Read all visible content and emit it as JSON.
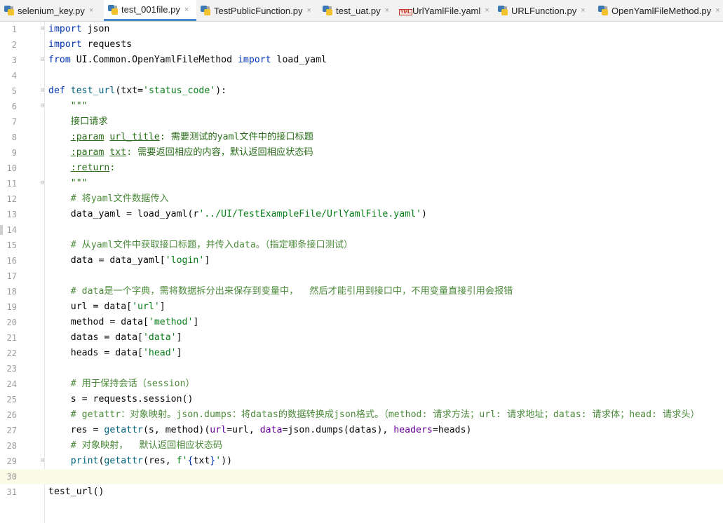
{
  "tabs": [
    {
      "label": "selenium_key.py",
      "icon": "python-file-icon",
      "active": false
    },
    {
      "label": "test_001file.py",
      "icon": "python-file-icon",
      "active": true
    },
    {
      "label": "TestPublicFunction.py",
      "icon": "python-file-icon",
      "active": false
    },
    {
      "label": "test_uat.py",
      "icon": "python-file-icon",
      "active": false
    },
    {
      "label": "UrlYamlFile.yaml",
      "icon": "yaml-file-icon",
      "active": false
    },
    {
      "label": "URLFunction.py",
      "icon": "python-file-icon",
      "active": false
    },
    {
      "label": "OpenYamlFileMethod.py",
      "icon": "python-file-icon",
      "active": false
    }
  ],
  "tab_close_glyph": "×",
  "yaml_badge": "YML",
  "colors": {
    "keyword": "#0033b3",
    "string": "#067d17",
    "function": "#00627a",
    "comment": "#4b8a3a",
    "kwarg": "#660099",
    "current_line": "#fcfbe6",
    "active_tab_underline": "#4a88c7"
  },
  "editor": {
    "current_line": 30,
    "lines": [
      {
        "n": "1",
        "fold": "⊟",
        "t": [
          [
            "kw",
            "import"
          ],
          [
            "id",
            " json"
          ]
        ]
      },
      {
        "n": "2",
        "t": [
          [
            "kw",
            "import"
          ],
          [
            "id",
            " requests"
          ]
        ]
      },
      {
        "n": "3",
        "fold": "⊟",
        "t": [
          [
            "kw",
            "from"
          ],
          [
            "id",
            " UI.Common.OpenYamlFileMethod "
          ],
          [
            "kw",
            "import"
          ],
          [
            "id",
            " load_yaml"
          ]
        ]
      },
      {
        "n": "4",
        "t": []
      },
      {
        "n": "5",
        "fold": "⊟",
        "t": [
          [
            "kw",
            "def"
          ],
          [
            "id",
            " "
          ],
          [
            "fn",
            "test_url"
          ],
          [
            "id",
            "(txt="
          ],
          [
            "str",
            "'status_code'"
          ],
          [
            "id",
            "):"
          ]
        ]
      },
      {
        "n": "6",
        "fold": "⊟",
        "t": [
          [
            "id",
            "    "
          ],
          [
            "doc",
            "\"\"\""
          ]
        ]
      },
      {
        "n": "7",
        "t": [
          [
            "id",
            "    "
          ],
          [
            "doc",
            "接口请求"
          ]
        ]
      },
      {
        "n": "8",
        "t": [
          [
            "id",
            "    "
          ],
          [
            "tag",
            ":param"
          ],
          [
            "doc",
            " "
          ],
          [
            "tag",
            "url_title"
          ],
          [
            "doc",
            ": 需要测试的yaml文件中的接口标题"
          ]
        ]
      },
      {
        "n": "9",
        "t": [
          [
            "id",
            "    "
          ],
          [
            "tag",
            ":param"
          ],
          [
            "doc",
            " "
          ],
          [
            "tag",
            "txt"
          ],
          [
            "doc",
            ": 需要返回相应的内容，默认返回相应状态码"
          ]
        ]
      },
      {
        "n": "10",
        "t": [
          [
            "id",
            "    "
          ],
          [
            "tag",
            ":return"
          ],
          [
            "doc",
            ":"
          ]
        ]
      },
      {
        "n": "11",
        "fold": "⊟",
        "t": [
          [
            "id",
            "    "
          ],
          [
            "doc",
            "\"\"\""
          ]
        ]
      },
      {
        "n": "12",
        "t": [
          [
            "id",
            "    "
          ],
          [
            "com",
            "# 将yaml文件数据传入"
          ]
        ]
      },
      {
        "n": "13",
        "t": [
          [
            "id",
            "    data_yaml = load_yaml(r"
          ],
          [
            "str",
            "'../UI/TestExampleFile/UrlYamlFile.yaml'"
          ],
          [
            "id",
            ")"
          ]
        ]
      },
      {
        "n": "14",
        "t": []
      },
      {
        "n": "15",
        "t": [
          [
            "id",
            "    "
          ],
          [
            "com",
            "# 从yaml文件中获取接口标题，并传入data。（指定哪条接口测试）"
          ]
        ]
      },
      {
        "n": "16",
        "t": [
          [
            "id",
            "    data = data_yaml["
          ],
          [
            "str",
            "'login'"
          ],
          [
            "id",
            "]"
          ]
        ]
      },
      {
        "n": "17",
        "t": []
      },
      {
        "n": "18",
        "t": [
          [
            "id",
            "    "
          ],
          [
            "com",
            "# data是一个字典，需将数据拆分出来保存到变量中，  然后才能引用到接口中，不用变量直接引用会报错"
          ]
        ]
      },
      {
        "n": "19",
        "t": [
          [
            "id",
            "    url = data["
          ],
          [
            "str",
            "'url'"
          ],
          [
            "id",
            "]"
          ]
        ]
      },
      {
        "n": "20",
        "t": [
          [
            "id",
            "    method = data["
          ],
          [
            "str",
            "'method'"
          ],
          [
            "id",
            "]"
          ]
        ]
      },
      {
        "n": "21",
        "t": [
          [
            "id",
            "    datas = data["
          ],
          [
            "str",
            "'data'"
          ],
          [
            "id",
            "]"
          ]
        ]
      },
      {
        "n": "22",
        "t": [
          [
            "id",
            "    heads = data["
          ],
          [
            "str",
            "'head'"
          ],
          [
            "id",
            "]"
          ]
        ]
      },
      {
        "n": "23",
        "t": []
      },
      {
        "n": "24",
        "t": [
          [
            "id",
            "    "
          ],
          [
            "com",
            "# 用于保持会话（session）"
          ]
        ]
      },
      {
        "n": "25",
        "t": [
          [
            "id",
            "    s = requests.session()"
          ]
        ]
      },
      {
        "n": "26",
        "t": [
          [
            "id",
            "    "
          ],
          [
            "com",
            "# getattr：对象映射。json.dumps：将datas的数据转换成json格式。（method: 请求方法；url: 请求地址；datas: 请求体；head: 请求头）"
          ]
        ]
      },
      {
        "n": "27",
        "t": [
          [
            "id",
            "    res = "
          ],
          [
            "fn",
            "getattr"
          ],
          [
            "id",
            "(s, method)("
          ],
          [
            "kwarg",
            "url"
          ],
          [
            "id",
            "=url, "
          ],
          [
            "kwarg",
            "data"
          ],
          [
            "id",
            "=json.dumps(datas), "
          ],
          [
            "kwarg",
            "headers"
          ],
          [
            "id",
            "=heads)"
          ]
        ]
      },
      {
        "n": "28",
        "t": [
          [
            "id",
            "    "
          ],
          [
            "com",
            "# 对象映射，  默认返回相应状态码"
          ]
        ]
      },
      {
        "n": "29",
        "fold": "⊟",
        "t": [
          [
            "id",
            "    "
          ],
          [
            "fn",
            "print"
          ],
          [
            "id",
            "("
          ],
          [
            "fn",
            "getattr"
          ],
          [
            "id",
            "(res, "
          ],
          [
            "str",
            "f'"
          ],
          [
            "kw",
            "{"
          ],
          [
            "id",
            "txt"
          ],
          [
            "kw",
            "}"
          ],
          [
            "str",
            "'"
          ],
          [
            "id",
            "))"
          ]
        ]
      },
      {
        "n": "30",
        "t": []
      },
      {
        "n": "31",
        "t": [
          [
            "id",
            "test_url()"
          ]
        ]
      }
    ]
  }
}
